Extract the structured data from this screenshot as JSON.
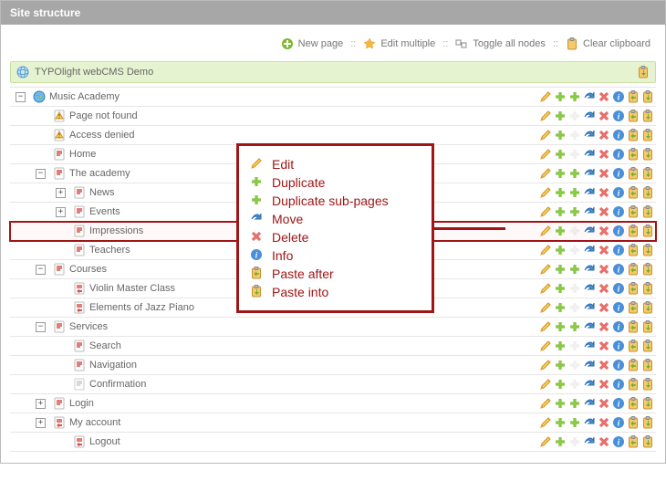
{
  "panel": {
    "title": "Site structure"
  },
  "toolbar": {
    "new_page": "New page",
    "edit_multiple": "Edit multiple",
    "toggle_all": "Toggle all nodes",
    "clear_clipboard": "Clear clipboard",
    "sep": "::"
  },
  "root": {
    "title": "TYPOlight webCMS Demo"
  },
  "tree": [
    {
      "depth": 1,
      "type": "root",
      "exp": "-",
      "title": "Music Academy",
      "actions": [
        "edit",
        "dup",
        "dupsub",
        "move",
        "del",
        "info",
        "pafter",
        "pinto"
      ]
    },
    {
      "depth": 2,
      "type": "err404",
      "exp": "",
      "title": "Page not found",
      "actions": [
        "edit",
        "dup",
        "dupsub_d",
        "move",
        "del",
        "info",
        "pafter",
        "pinto"
      ]
    },
    {
      "depth": 2,
      "type": "err403",
      "exp": "",
      "title": "Access denied",
      "actions": [
        "edit",
        "dup",
        "dupsub_d",
        "move",
        "del",
        "info",
        "pafter",
        "pinto"
      ]
    },
    {
      "depth": 2,
      "type": "page",
      "exp": "",
      "title": "Home",
      "actions": [
        "edit",
        "dup",
        "dupsub_d",
        "move",
        "del",
        "info",
        "pafter",
        "pinto"
      ]
    },
    {
      "depth": 2,
      "type": "page",
      "exp": "-",
      "title": "The academy",
      "actions": [
        "edit",
        "dup",
        "dupsub",
        "move",
        "del",
        "info",
        "pafter",
        "pinto"
      ]
    },
    {
      "depth": 3,
      "type": "page",
      "exp": "+",
      "title": "News",
      "actions": [
        "edit",
        "dup",
        "dupsub",
        "move",
        "del",
        "info",
        "pafter",
        "pinto"
      ]
    },
    {
      "depth": 3,
      "type": "page",
      "exp": "+",
      "title": "Events",
      "actions": [
        "edit",
        "dup",
        "dupsub",
        "move",
        "del",
        "info",
        "pafter",
        "pinto"
      ]
    },
    {
      "depth": 3,
      "type": "page",
      "exp": "",
      "title": "Impressions",
      "actions": [
        "edit",
        "dup",
        "dupsub_d",
        "move",
        "del",
        "info",
        "pafter",
        "pinto"
      ],
      "highlight": true
    },
    {
      "depth": 3,
      "type": "page",
      "exp": "",
      "title": "Teachers",
      "actions": [
        "edit",
        "dup",
        "dupsub_d",
        "move",
        "del",
        "info",
        "pafter",
        "pinto"
      ]
    },
    {
      "depth": 2,
      "type": "page",
      "exp": "-",
      "title": "Courses",
      "actions": [
        "edit",
        "dup",
        "dupsub",
        "move",
        "del",
        "info",
        "pafter",
        "pinto"
      ]
    },
    {
      "depth": 3,
      "type": "redirect",
      "exp": "",
      "title": "Violin Master Class",
      "actions": [
        "edit",
        "dup",
        "dupsub_d",
        "move",
        "del",
        "info",
        "pafter",
        "pinto"
      ]
    },
    {
      "depth": 3,
      "type": "redirect",
      "exp": "",
      "title": "Elements of Jazz Piano",
      "actions": [
        "edit",
        "dup",
        "dupsub_d",
        "move",
        "del",
        "info",
        "pafter",
        "pinto"
      ]
    },
    {
      "depth": 2,
      "type": "page",
      "exp": "-",
      "title": "Services",
      "actions": [
        "edit",
        "dup",
        "dupsub",
        "move",
        "del",
        "info",
        "pafter",
        "pinto"
      ]
    },
    {
      "depth": 3,
      "type": "page",
      "exp": "",
      "title": "Search",
      "actions": [
        "edit",
        "dup",
        "dupsub_d",
        "move",
        "del",
        "info",
        "pafter",
        "pinto"
      ]
    },
    {
      "depth": 3,
      "type": "page",
      "exp": "",
      "title": "Navigation",
      "actions": [
        "edit",
        "dup",
        "dupsub_d",
        "move",
        "del",
        "info",
        "pafter",
        "pinto"
      ]
    },
    {
      "depth": 3,
      "type": "hidden",
      "exp": "",
      "title": "Confirmation",
      "actions": [
        "edit",
        "dup",
        "dupsub_d",
        "move",
        "del",
        "info",
        "pafter",
        "pinto"
      ]
    },
    {
      "depth": 2,
      "type": "page",
      "exp": "+",
      "title": "Login",
      "actions": [
        "edit",
        "dup",
        "dupsub",
        "move",
        "del",
        "info",
        "pafter",
        "pinto"
      ]
    },
    {
      "depth": 2,
      "type": "redirect",
      "exp": "+",
      "title": "My account",
      "actions": [
        "edit",
        "dup",
        "dupsub",
        "move",
        "del",
        "info",
        "pafter",
        "pinto"
      ]
    },
    {
      "depth": 3,
      "type": "redirect",
      "exp": "",
      "title": "Logout",
      "actions": [
        "edit",
        "dup",
        "dupsub_d",
        "move",
        "del",
        "info",
        "pafter",
        "pinto"
      ]
    }
  ],
  "legend": {
    "edit": "Edit",
    "dup": "Duplicate",
    "dupsub": "Duplicate sub-pages",
    "move": "Move",
    "del": "Delete",
    "info": "Info",
    "pafter": "Paste after",
    "pinto": "Paste into"
  }
}
